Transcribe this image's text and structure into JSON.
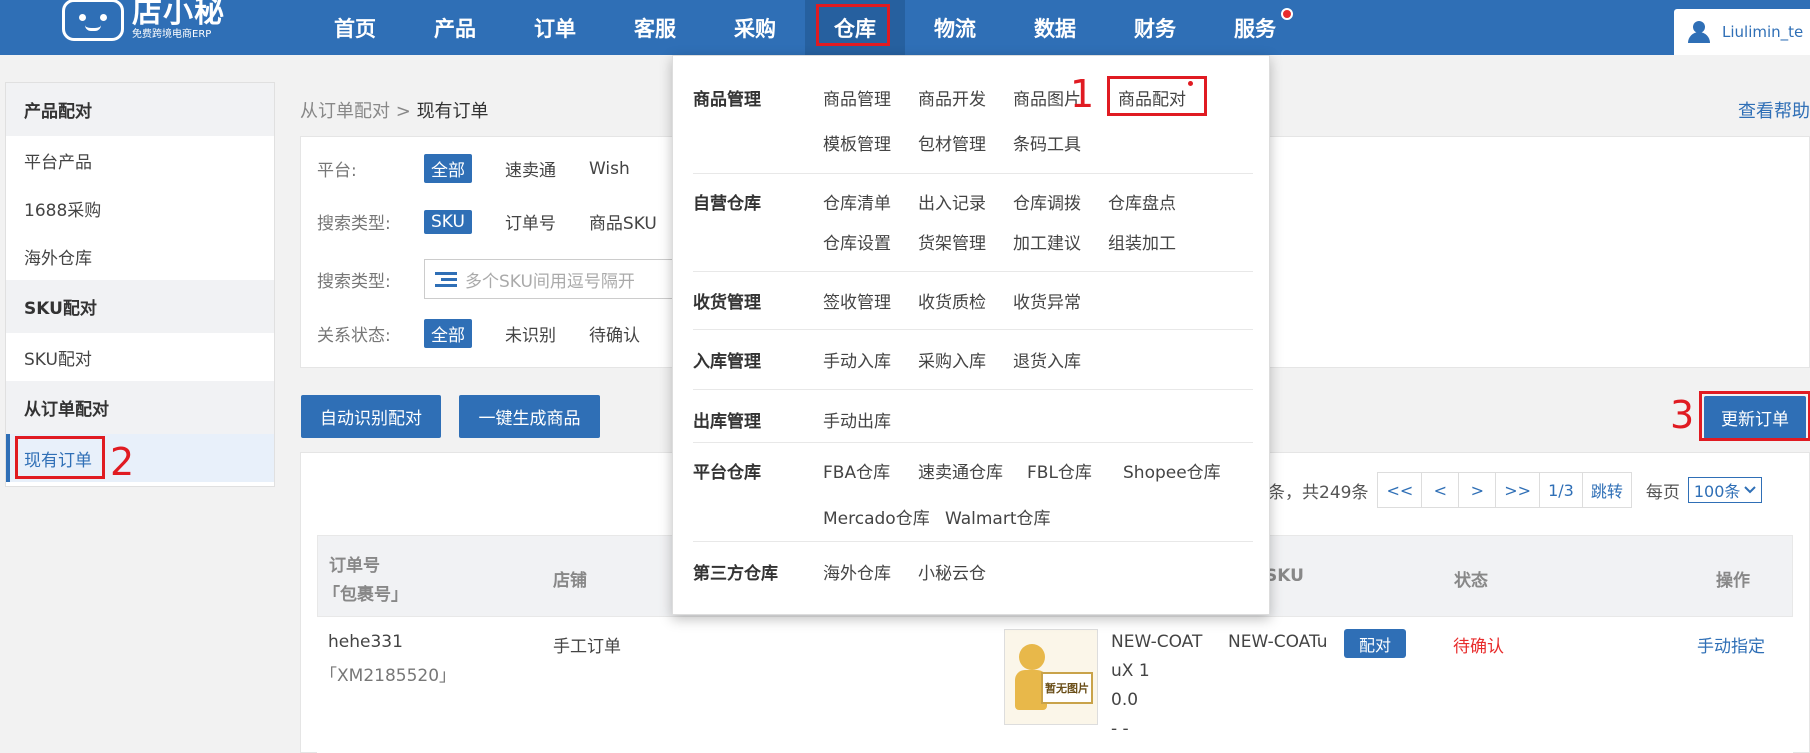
{
  "brand": {
    "name": "店小秘",
    "subtitle": "免费跨境电商ERP"
  },
  "nav": {
    "items": [
      {
        "label": "首页"
      },
      {
        "label": "产品"
      },
      {
        "label": "订单"
      },
      {
        "label": "客服"
      },
      {
        "label": "采购"
      },
      {
        "label": "仓库"
      },
      {
        "label": "物流"
      },
      {
        "label": "数据"
      },
      {
        "label": "财务"
      },
      {
        "label": "服务"
      }
    ],
    "active_index": 5
  },
  "user": {
    "name": "Liulimin_te"
  },
  "sidebar": {
    "sections": [
      {
        "title": "产品配对",
        "items": [
          "平台产品",
          "1688采购",
          "海外仓库"
        ]
      },
      {
        "title": "SKU配对",
        "items": [
          "SKU配对"
        ]
      },
      {
        "title": "从订单配对",
        "items": [
          "现有订单"
        ]
      }
    ],
    "active_item": "现有订单"
  },
  "breadcrumb": {
    "parent": "从订单配对",
    "separator": ">",
    "current": "现有订单"
  },
  "help_link": "查看帮助",
  "filters": {
    "platform": {
      "label": "平台:",
      "options": [
        "全部",
        "速卖通",
        "Wish"
      ],
      "selected": "全部"
    },
    "search_type": {
      "label": "搜索类型:",
      "options": [
        "SKU",
        "订单号",
        "商品SKU"
      ],
      "selected": "SKU"
    },
    "search_input": {
      "label": "搜索类型:",
      "placeholder": "多个SKU间用逗号隔开"
    },
    "relation_status": {
      "label": "关系状态:",
      "options": [
        "全部",
        "未识别",
        "待确认"
      ],
      "selected": "全部"
    }
  },
  "actions": {
    "auto_match": "自动识别配对",
    "generate": "一键生成商品",
    "update_orders": "更新订单"
  },
  "pagination": {
    "summary": "条，共249条",
    "first": "<<",
    "prev": "<",
    "next": ">",
    "last": ">>",
    "page": "1/3",
    "jump": "跳转",
    "per_page_label": "每页",
    "per_page_value": "100条"
  },
  "table": {
    "headers": {
      "order_no": "订单号",
      "package_no": "「包裹号」",
      "shop": "店铺",
      "sku": "SKU",
      "status": "状态",
      "action": "操作"
    },
    "rows": [
      {
        "order_no": "hehe331",
        "package_no": "「XM2185520」",
        "shop": "手工订单",
        "image_text": "暂无图片",
        "product_line1": "NEW-COAT",
        "product_line2": "uX 1",
        "product_line3": "0.0",
        "product_line4": "- -",
        "sku": "NEW-COATu",
        "tag": "配对",
        "status": "待确认",
        "action": "手动指定"
      }
    ]
  },
  "warehouse_menu": {
    "sections": [
      {
        "title": "商品管理",
        "links": [
          "商品管理",
          "商品开发",
          "商品图片",
          "商品配对",
          "模板管理",
          "包材管理",
          "条码工具"
        ]
      },
      {
        "title": "自营仓库",
        "links": [
          "仓库清单",
          "出入记录",
          "仓库调拨",
          "仓库盘点",
          "仓库设置",
          "货架管理",
          "加工建议",
          "组装加工"
        ]
      },
      {
        "title": "收货管理",
        "links": [
          "签收管理",
          "收货质检",
          "收货异常"
        ]
      },
      {
        "title": "入库管理",
        "links": [
          "手动入库",
          "采购入库",
          "退货入库"
        ]
      },
      {
        "title": "出库管理",
        "links": [
          "手动出库"
        ]
      },
      {
        "title": "平台仓库",
        "links": [
          "FBA仓库",
          "速卖通仓库",
          "FBL仓库",
          "Shopee仓库",
          "Mercado仓库",
          "Walmart仓库"
        ]
      },
      {
        "title": "第三方仓库",
        "links": [
          "海外仓库",
          "小秘云仓"
        ]
      }
    ]
  },
  "annotations": {
    "step1": "1",
    "step2": "2",
    "step3": "3"
  },
  "colors": {
    "brand_blue": "#2f6fb6",
    "highlight_red": "#e01b22",
    "status_red": "#e82c2c"
  }
}
